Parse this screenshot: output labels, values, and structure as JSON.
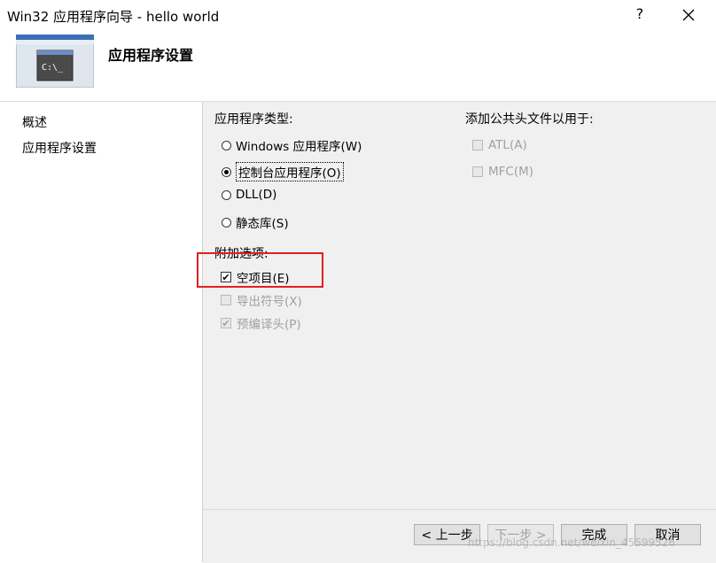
{
  "window": {
    "title": "Win32 应用程序向导 - hello world",
    "help": "?",
    "close": "close"
  },
  "header": {
    "page_title": "应用程序设置",
    "logo_text": "C:\\_"
  },
  "nav": {
    "items": [
      {
        "label": "概述"
      },
      {
        "label": "应用程序设置"
      }
    ]
  },
  "app_type": {
    "label": "应用程序类型:",
    "options": [
      {
        "label": "Windows 应用程序(W)",
        "selected": false
      },
      {
        "label": "控制台应用程序(O)",
        "selected": true
      },
      {
        "label": "DLL(D)",
        "selected": false
      },
      {
        "label": "静态库(S)",
        "selected": false
      }
    ]
  },
  "common_headers": {
    "label": "添加公共头文件以用于:",
    "options": [
      {
        "label": "ATL(A)",
        "checked": false,
        "enabled": false
      },
      {
        "label": "MFC(M)",
        "checked": false,
        "enabled": false
      }
    ]
  },
  "extra": {
    "label": "附加选项:",
    "options": [
      {
        "label": "空项目(E)",
        "checked": true,
        "enabled": true
      },
      {
        "label": "导出符号(X)",
        "checked": false,
        "enabled": false
      },
      {
        "label": "预编译头(P)",
        "checked": true,
        "enabled": false
      }
    ]
  },
  "buttons": {
    "prev": "< 上一步",
    "next": "下一步 >",
    "finish": "完成",
    "cancel": "取消"
  },
  "watermark": "https://blog.csdn.net/weixin_45599526"
}
